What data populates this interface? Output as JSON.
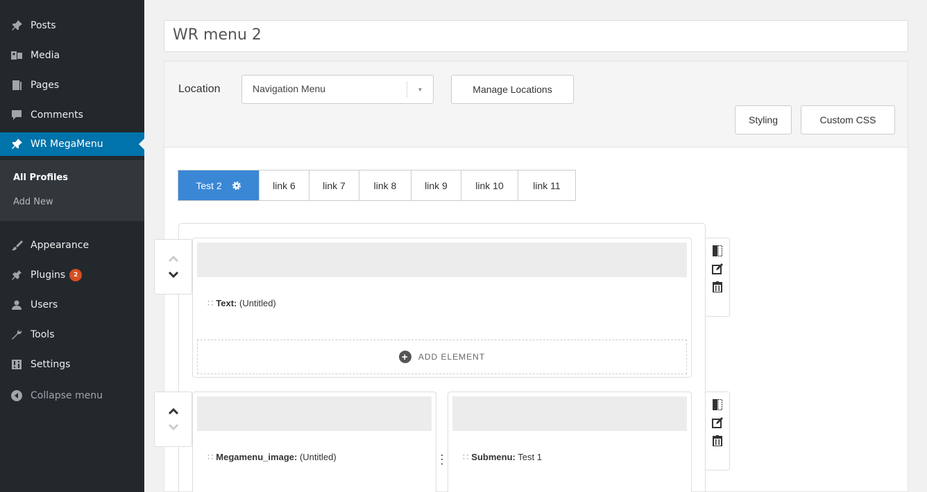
{
  "sidebar": {
    "items": [
      {
        "label": "Posts",
        "icon": "pin-icon"
      },
      {
        "label": "Media",
        "icon": "media-icon"
      },
      {
        "label": "Pages",
        "icon": "pages-icon"
      },
      {
        "label": "Comments",
        "icon": "comment-icon"
      },
      {
        "label": "WR MegaMenu",
        "icon": "pin-icon"
      },
      {
        "label": "Appearance",
        "icon": "brush-icon"
      },
      {
        "label": "Plugins",
        "icon": "plugin-icon",
        "badge": "2"
      },
      {
        "label": "Users",
        "icon": "user-icon"
      },
      {
        "label": "Tools",
        "icon": "wrench-icon"
      },
      {
        "label": "Settings",
        "icon": "settings-icon"
      },
      {
        "label": "Collapse menu",
        "icon": "collapse-icon"
      }
    ],
    "submenu": [
      "All Profiles",
      "Add New"
    ]
  },
  "menu_title": "WR menu 2",
  "location": {
    "label": "Location",
    "selected": "Navigation Menu",
    "manage_label": "Manage Locations"
  },
  "buttons": {
    "styling": "Styling",
    "custom_css": "Custom CSS"
  },
  "tabs": [
    "Test 2",
    "link 6",
    "link 7",
    "link 8",
    "link 9",
    "link 10",
    "link 11"
  ],
  "rows": [
    {
      "columns": [
        {
          "element_type": "Text:",
          "element_name": "(Untitled)",
          "add_label": "ADD ELEMENT"
        }
      ]
    },
    {
      "columns": [
        {
          "element_type": "Megamenu_image:",
          "element_name": "(Untitled)"
        },
        {
          "element_type": "Submenu:",
          "element_name": "Test 1"
        }
      ]
    }
  ],
  "colors": {
    "sidebar_bg": "#23282d",
    "active_menu": "#0073aa",
    "active_tab": "#3a87d6",
    "badge": "#d54e21"
  }
}
